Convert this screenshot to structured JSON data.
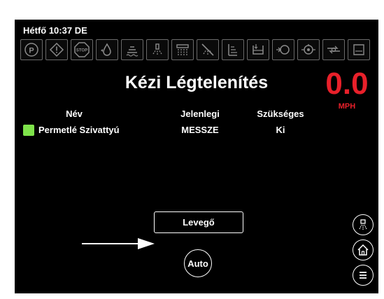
{
  "header": {
    "datetime": "Hétfő 10:37 DE"
  },
  "status_icons": [
    "parking-brake-icon",
    "warning-icon",
    "stop-icon",
    "tank-level-icon",
    "boom-height-icon",
    "nozzle-spray-icon",
    "section-spray-icon",
    "spray-off-icon",
    "boom-level-icon",
    "fill-level-icon",
    "pump-icon",
    "valve-icon",
    "agitation-icon",
    "rinse-tank-icon"
  ],
  "title": "Kézi Légtelenítés",
  "speed": {
    "value": "0.0",
    "unit": "MPH",
    "color": "#e8202a"
  },
  "table": {
    "headers": {
      "name": "Név",
      "current": "Jelenlegi",
      "required": "Szükséges"
    },
    "rows": [
      {
        "status_color": "#7ee24a",
        "name": "Permetlé Szivattyú",
        "current": "MESSZE",
        "required": "Ki"
      }
    ]
  },
  "buttons": {
    "air": "Levegő",
    "auto": "Auto"
  },
  "side_buttons": [
    "nozzle-icon",
    "home-icon",
    "menu-icon"
  ]
}
